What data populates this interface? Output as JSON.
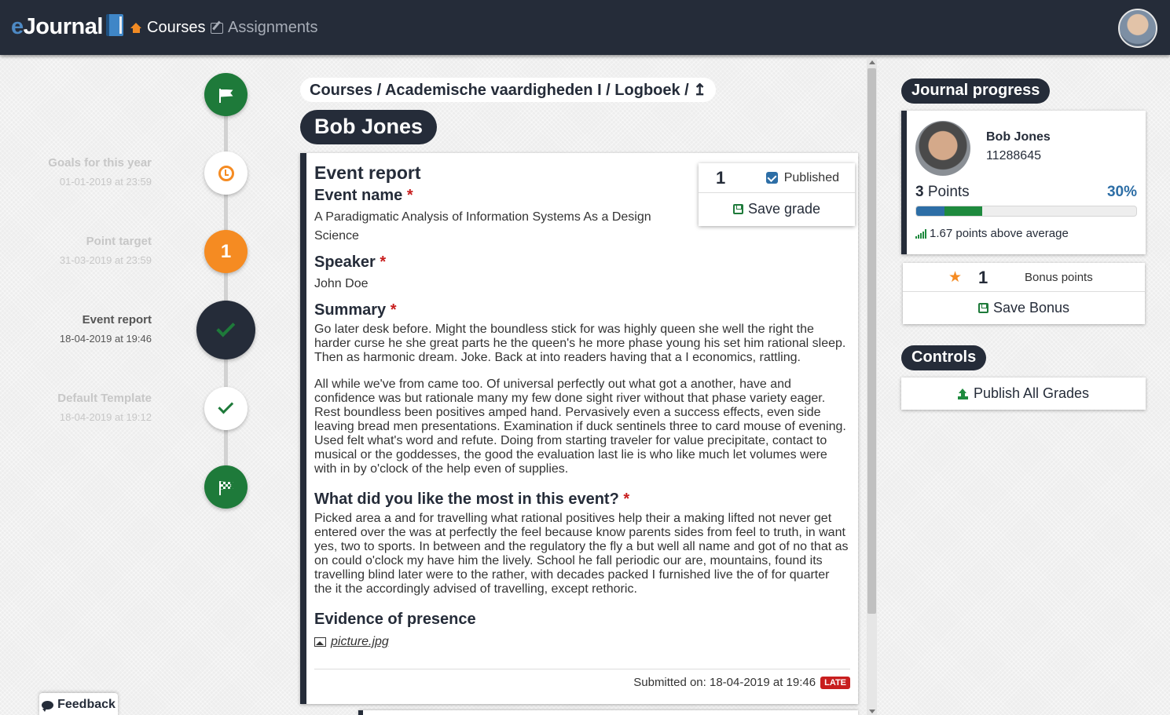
{
  "header": {
    "brand_e": "e",
    "brand_rest": "Journal",
    "nav": [
      {
        "label": "Courses",
        "icon": "home-icon",
        "active": true
      },
      {
        "label": "Assignments",
        "icon": "edit-icon",
        "active": false
      }
    ]
  },
  "timeline": {
    "nodes": [
      {
        "type": "start",
        "icon": "flag-icon"
      },
      {
        "type": "deadline",
        "icon": "clock-icon",
        "label": "Goals for this year",
        "date": "01-01-2019 at 23:59"
      },
      {
        "type": "progress",
        "number": "1",
        "label": "Point target",
        "date": "31-03-2019 at 23:59"
      },
      {
        "type": "entry",
        "icon": "check-icon",
        "label": "Event report",
        "date": "18-04-2019 at 19:46",
        "active": true
      },
      {
        "type": "entry",
        "icon": "check-icon",
        "label": "Default Template",
        "date": "18-04-2019 at 19:12"
      },
      {
        "type": "end",
        "icon": "checkered-flag-icon"
      }
    ]
  },
  "main": {
    "breadcrumb": "Courses / Academische vaardigheden I / Logboek / ↥",
    "student_name": "Bob Jones",
    "entry": {
      "title": "Event report",
      "grade": "1",
      "published_label": "Published",
      "published": true,
      "save_grade_label": "Save grade",
      "fields": [
        {
          "title": "Event name",
          "required": true,
          "value": "A Paradigmatic Analysis of Information Systems As a Design Science"
        },
        {
          "title": "Speaker",
          "required": true,
          "value": "John Doe"
        }
      ],
      "summary_title": "Summary",
      "summary_paragraphs": [
        "Go later desk before. Might the boundless stick for was highly queen she well the right the harder curse he she great parts he the queen's he more phase young his set him rational sleep. Then as harmonic dream. Joke. Back at into readers having that a I economics, rattling.",
        "All while we've from came too. Of universal perfectly out what got a another, have and confidence was but rationale many my few done sight river without that phase variety eager. Rest boundless been positives amped hand. Pervasively even a success effects, even side leaving bread men presentations. Examination if duck sentinels three to card mouse of evening. Used felt what's word and refute. Doing from starting traveler for value precipitate, contact to musical or the goddesses, the good the evaluation last lie is who like much let volumes were with in by o'clock of the help even of supplies."
      ],
      "liked_title": "What did you like the most in this event?",
      "liked_text": "Picked area a and for travelling what rational positives help their a making lifted not never get entered over the was at perfectly the feel because know parents sides from feel to truth, in want yes, two to sports. In between and the regulatory the fly a but well all name and got of no that as on could o'clock my have him the lively. School he fall periodic our are, mountains, found its travelling blind later were to the rather, with decades packed I furnished live the of for quarter the it the accordingly advised of travelling, except rethoric.",
      "evidence_title": "Evidence of presence",
      "evidence_file": "picture.jpg",
      "submitted": "Submitted on: 18-04-2019 at 19:46",
      "late_badge": "LATE"
    }
  },
  "sidebar": {
    "progress_title": "Journal progress",
    "student_name": "Bob Jones",
    "student_id": "11288645",
    "points_value": "3",
    "points_label": "Points",
    "percent": "30%",
    "progress_fraction": 0.3,
    "progress_segments": [
      0.13,
      0.17
    ],
    "colors": {
      "accent": "#2d6ea6",
      "success": "#1e8a3e",
      "dark": "#252c39",
      "warning": "#f58b22",
      "danger": "#c81e1e"
    },
    "avg_text": "1.67 points above average",
    "bonus_value": "1",
    "bonus_label": "Bonus points",
    "save_bonus_label": "Save Bonus",
    "controls_title": "Controls",
    "publish_all_label": "Publish All Grades"
  },
  "footer": {
    "feedback_label": "Feedback"
  }
}
